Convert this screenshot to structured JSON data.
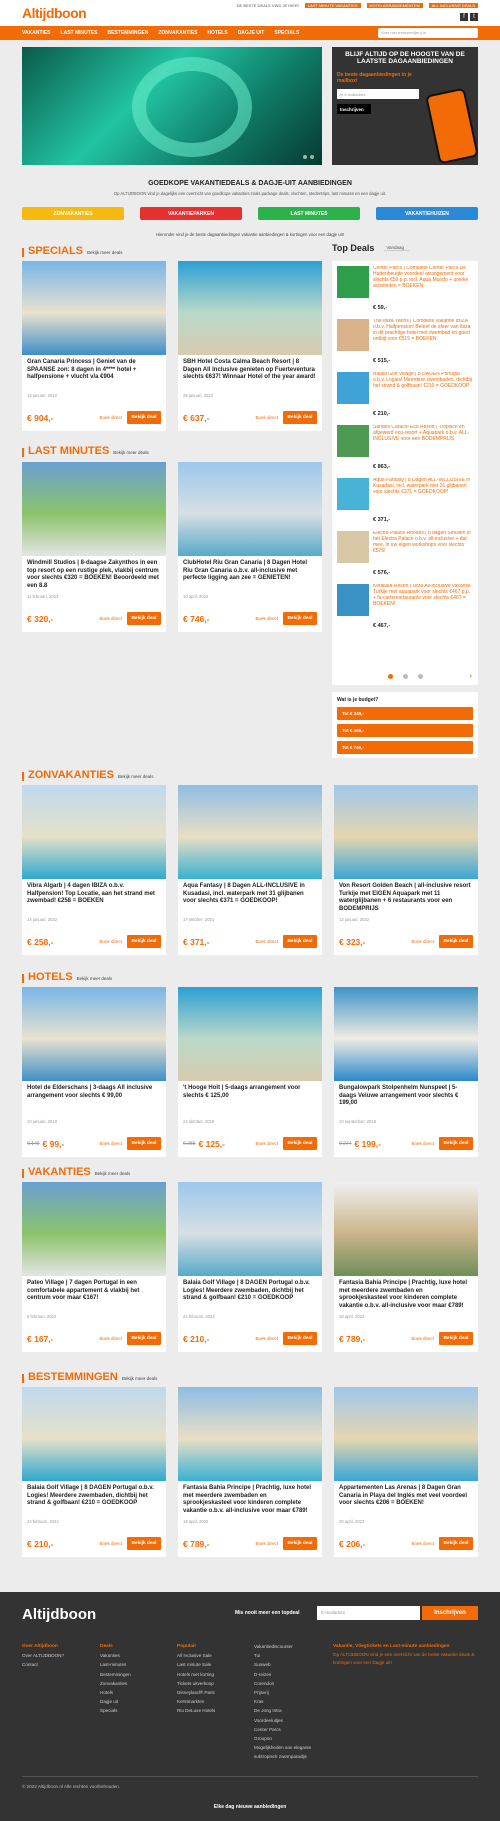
{
  "header": {
    "logo": "Altijdboon",
    "links": [
      "DE BESTE DEALS VIND JE HIER!",
      "LAST MINUTE VAKANTIES",
      "HOTELARRANGEMENTEN",
      "ALL INCLUSIVE DEALS"
    ],
    "nav": [
      "VAKANTIES",
      "LAST MINUTES",
      "BESTEMMINGEN",
      "ZONVAKANTIES",
      "HOTELS",
      "DAGJE UIT",
      "SPECIALS"
    ],
    "search_placeholder": "Voer hier trefwoord(en) in"
  },
  "newsletter_box": {
    "title": "BLIJF ALTIJD OP DE HOOGTE VAN DE LAATSTE DAGAANBIEDINGEN",
    "sub": "De beste dagaanbiedingen in je mailbox!",
    "placeholder": "Je e-mailadres",
    "button": "Inschrijven"
  },
  "intro": {
    "title": "GOEDKOPE VAKANTIEDEALS & DAGJE-UIT AANBIEDINGEN",
    "text": "Op ALTIJDBOON vind je dagelijks een overzicht van goedkope vakanties zoals package deals, vluchten, stedentrips, last minutes en een dagje uit.",
    "categories": [
      {
        "label": "ZONVAKANTIES",
        "color": "#f5b90f"
      },
      {
        "label": "VAKANTIEPARKEN",
        "color": "#e53030"
      },
      {
        "label": "LAST MINUTES",
        "color": "#2cb24a"
      },
      {
        "label": "VAKANTIEHUIZEN",
        "color": "#2a8ad8"
      }
    ],
    "note": "Hieronder vind je de beste dagaanbiedingen vakantie aanbiedingen & kortingen voor een dagje uit!"
  },
  "common": {
    "book_direct": "Boek direct",
    "view_deal": "Bekijk deal",
    "more_deals": "Bekijk meer deals"
  },
  "sections": [
    {
      "title": "SPECIALS",
      "cards": [
        {
          "title": "Gran Canaria Princess | Geniet van de SPAANSE zon: 8 dagen in 4**** hotel + halfpensione + vlucht v/a €904",
          "date": "12 januari, 2022",
          "old": "",
          "price": "€ 904,-"
        },
        {
          "title": "SBH Hotel Costa Calma Beach Resort | 8 Dagen All Inclusive genieten op Fuerteventura slechts €637! Winnaar Hotel of the year award!",
          "date": "25 januari, 2022",
          "old": "",
          "price": "€ 637,-"
        }
      ]
    },
    {
      "title": "LAST MINUTES",
      "cards": [
        {
          "title": "Windmill Studios | 8-daagse Zakynthos in een top resort op een rustige plek, vlakbij centrum voor slechts €320 = BOEKEN! Beoordeeld met een 8.8",
          "date": "11 februari, 2022",
          "old": "",
          "price": "€ 320,-"
        },
        {
          "title": "ClubHotel Riu Gran Canaria | 8 Dagen Hotel Riu Gran Canaria o.b.v. all-inclusive met perfecte ligging aan zee = GENIETEN!",
          "date": "10 april, 2022",
          "old": "",
          "price": "€ 746,-"
        }
      ]
    },
    {
      "title": "ZONVAKANTIES",
      "cards": [
        {
          "title": "Vibra Algarb | 4 dagen IBIZA o.b.v. Halfpension! Top Locatie, aan het strand met zwembad! €258 = BOEKEN",
          "date": "14 januari, 2022",
          "old": "",
          "price": "€ 258,-"
        },
        {
          "title": "Aqua Fantasy | 8 Dagen ALL-INCLUSIVE in Kusadasi, incl. waterpark met 31 glijbanen voor slechts €371 = GOEDKOOP!",
          "date": "17 oktober, 2021",
          "old": "",
          "price": "€ 371,-"
        },
        {
          "title": "Von Resort Golden Beach | all-inclusive resort Turkije met EIGEN Aquapark met 11 waterglijbanen + 6 restaurants voor een BODEMPRIJS",
          "date": "12 januari, 2022",
          "old": "",
          "price": "€ 323,-"
        }
      ]
    },
    {
      "title": "HOTELS",
      "cards": [
        {
          "title": "Hotel de Elderschans | 3-daags All inclusive arrangement voor slechts € 99,00",
          "date": "10 januari, 2019",
          "old": "€ 149",
          "price": "€ 99,-"
        },
        {
          "title": "'t Hooge Holt | 5-daags arrangement voor slechts € 125,00",
          "date": "24 oktober, 2019",
          "old": "€ 255",
          "price": "€ 125,-"
        },
        {
          "title": "Bungalowpark Stolpenhelm Nunspeet | 5-daags Veluwe arrangement voor slechts € 199,00",
          "date": "10 september, 2019",
          "old": "€ 274",
          "price": "€ 199,-"
        }
      ]
    },
    {
      "title": "VAKANTIES",
      "cards": [
        {
          "title": "Pateo Village | 7 dagen Portugal in een comfortabele appartement & vlakbij het centrum voor maar €167!",
          "date": "9 februari, 2022",
          "old": "",
          "price": "€ 167,-"
        },
        {
          "title": "Balaia Golf Village | 8 DAGEN Portugal o.b.v. Logies! Meerdere zwembaden, dichtbij het strand & golfbaan! €210 = GOEDKOOP",
          "date": "24 februari, 2022",
          "old": "",
          "price": "€ 210,-"
        },
        {
          "title": "Fantasia Bahia Principe | Prachtig, luxe hotel met meerdere zwembaden en sprookjeskasteel voor kinderen complete vakantie o.b.v. all-inclusive voor maar €789!",
          "date": "18 april, 2022",
          "old": "",
          "price": "€ 789,-"
        }
      ]
    },
    {
      "title": "BESTEMMINGEN",
      "cards": [
        {
          "title": "Balaia Golf Village | 8 DAGEN Portugal o.b.v. Logies! Meerdere zwembaden, dichtbij het strand & golfbaan! €210 = GOEDKOOP",
          "date": "24 februari, 2022",
          "old": "",
          "price": "€ 210,-"
        },
        {
          "title": "Fantasia Bahia Principe | Prachtig, luxe hotel met meerdere zwembaden en sprookjeskasteel voor kinderen complete vakantie o.b.v. all-inclusive voor maar €789!",
          "date": "18 april, 2022",
          "old": "",
          "price": "€ 789,-"
        },
        {
          "title": "Appartementen Las Arenas | 8 Dagen Gran Canaria in Playa del Inglés met veel voordeel voor slechts €206 = BOEKEN!",
          "date": "20 april, 2022",
          "old": "",
          "price": "€ 206,-"
        }
      ]
    }
  ],
  "top_deals": {
    "title": "Top Deals",
    "filter": "Vandaag",
    "items": [
      {
        "text": "Center Parcs | Complete Center Parcs De Huttenheugte voordeel arrangement voor slechts €59 p.p. incl. Aqua Mundo + unieke activiteiten = BOEKEN",
        "price": "€ 59,-"
      },
      {
        "text": "The Ibiza Twiins | Complete vakantie IBIZA o.b.v. Halfpension! Beleef de sfeer van Ibiza in dit prachtige hotel met zwembad en goed ontbijt voor €515 = BOEKEN",
        "price": "€ 515,-"
      },
      {
        "text": "Balaia Golf Village | 8 DAGEN Portugal o.b.v. Logies! Meerdere zwembaden, dichtbij het strand & golfbaan! €210 = GOEDKOOP",
        "price": "€ 210,-"
      },
      {
        "text": "Sandos Caracol Eco Resort | Tropisch en afgewerd eco-resort + Aquapark o.b.v. ALL-INCLUSIVE voor een BODEMPRIJS",
        "price": "€ 863,-"
      },
      {
        "text": "Aqua Fantasy | 8 Dagen ALL-INCLUSIVE in Kusadasi, incl. waterpark met 31 glijbanen voor slechts €371 = GOEDKOOP!",
        "price": "€ 371,-"
      },
      {
        "text": "Electra Palace Rhodes | 8 dagen Smullen in het Electra Palace o.b.v. all-inclusive + dat mee, in uw eigen workshops voor slechts €576!",
        "price": "€ 576,-"
      },
      {
        "text": "Kefaluka Resort | Ultra All-inclusive vakantie Turkije met aquapark voor slechts €467 p.p. + fa-carteresrtaurants voor slechts €467 = BOEKEN!",
        "price": "€ 467,-"
      }
    ]
  },
  "budget": {
    "title": "Wat is je budget?",
    "options": [
      "Tot € 249,-",
      "Tot € 499,-",
      "Tot € 749,-"
    ]
  },
  "footer": {
    "newsletter_label": "Mis nooit meer een topdeal",
    "placeholder": "E-mailadres",
    "button": "Inschrijven",
    "cols": [
      {
        "title": "Over Altijdboon",
        "items": [
          "Over ALTIJDBOON?",
          "Contact"
        ]
      },
      {
        "title": "Deals",
        "items": [
          "Vakanties",
          "Last-minutes",
          "Bestemmingen",
          "Zonvakanties",
          "Hotels",
          "Dagje uit",
          "Specials"
        ]
      },
      {
        "title": "Populair",
        "items": [
          "All Inclusive Sale",
          "Last minute Sale",
          "Hotels met korting",
          "Tickets uitverkoop",
          "Disneyland® Paris",
          "Kerstmarkten",
          "Riu DeLuxe Hotels"
        ]
      },
      {
        "title": "",
        "items": [
          "Vakantiediscounter",
          "Tui",
          "Sunweb",
          "D-reizen",
          "Corendon",
          "Prijsvrij",
          "Kras",
          "De Jong Intra",
          "Voordeeluitjes",
          "Center Parcs",
          "Groupon",
          "Mogelijkheden van elegante subtropisch zwemparadijs"
        ]
      }
    ],
    "about_title": "Vakantie, Vliegtickets en Last-minute aanbiedingen",
    "about_text": "Op ALTIJDBOON vind je een overzicht van de beste vakantie deals & kortingen voor een Dagje uit!",
    "copyright": "© 2022 Altijdboon.nl Alle rechten voorbehouden.",
    "tagline": "Elke dag nieuwe aanbiedingen"
  }
}
